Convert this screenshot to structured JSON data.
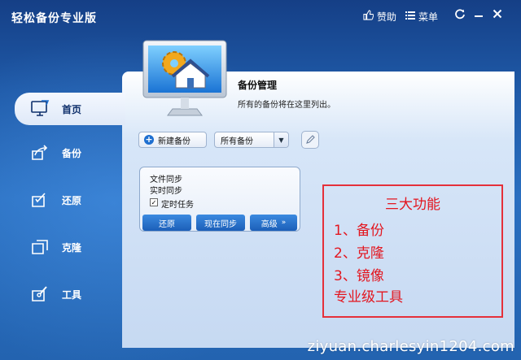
{
  "app": {
    "title": "轻松备份专业版",
    "toolbar": {
      "like_label": "赞助",
      "menu_label": "菜单"
    }
  },
  "sidebar": {
    "items": [
      {
        "label": "首页",
        "icon": "home-monitor-icon",
        "active": true
      },
      {
        "label": "备份",
        "icon": "backup-icon",
        "active": false
      },
      {
        "label": "还原",
        "icon": "restore-icon",
        "active": false
      },
      {
        "label": "克隆",
        "icon": "clone-icon",
        "active": false
      },
      {
        "label": "工具",
        "icon": "tools-icon",
        "active": false
      }
    ]
  },
  "header": {
    "title": "备份管理",
    "subtitle": "所有的备份将在这里列出。"
  },
  "actions": {
    "new_backup": "新建备份",
    "filter_value": "所有备份"
  },
  "task": {
    "line1": "文件同步",
    "line2": "实时同步",
    "schedule_label": "定时任务",
    "buttons": {
      "restore": "还原",
      "sync_now": "现在同步",
      "advanced": "高级"
    }
  },
  "annotation": {
    "title": "三大功能",
    "lines": [
      "1、备份",
      "2、克隆",
      "3、镜像",
      "专业级工具"
    ]
  },
  "watermark": "ziyuan.charlesyin1204.com",
  "colors": {
    "accent": "#1e6fd0",
    "annotation": "#e3161f",
    "panel_bg": "#d7e6f8"
  }
}
